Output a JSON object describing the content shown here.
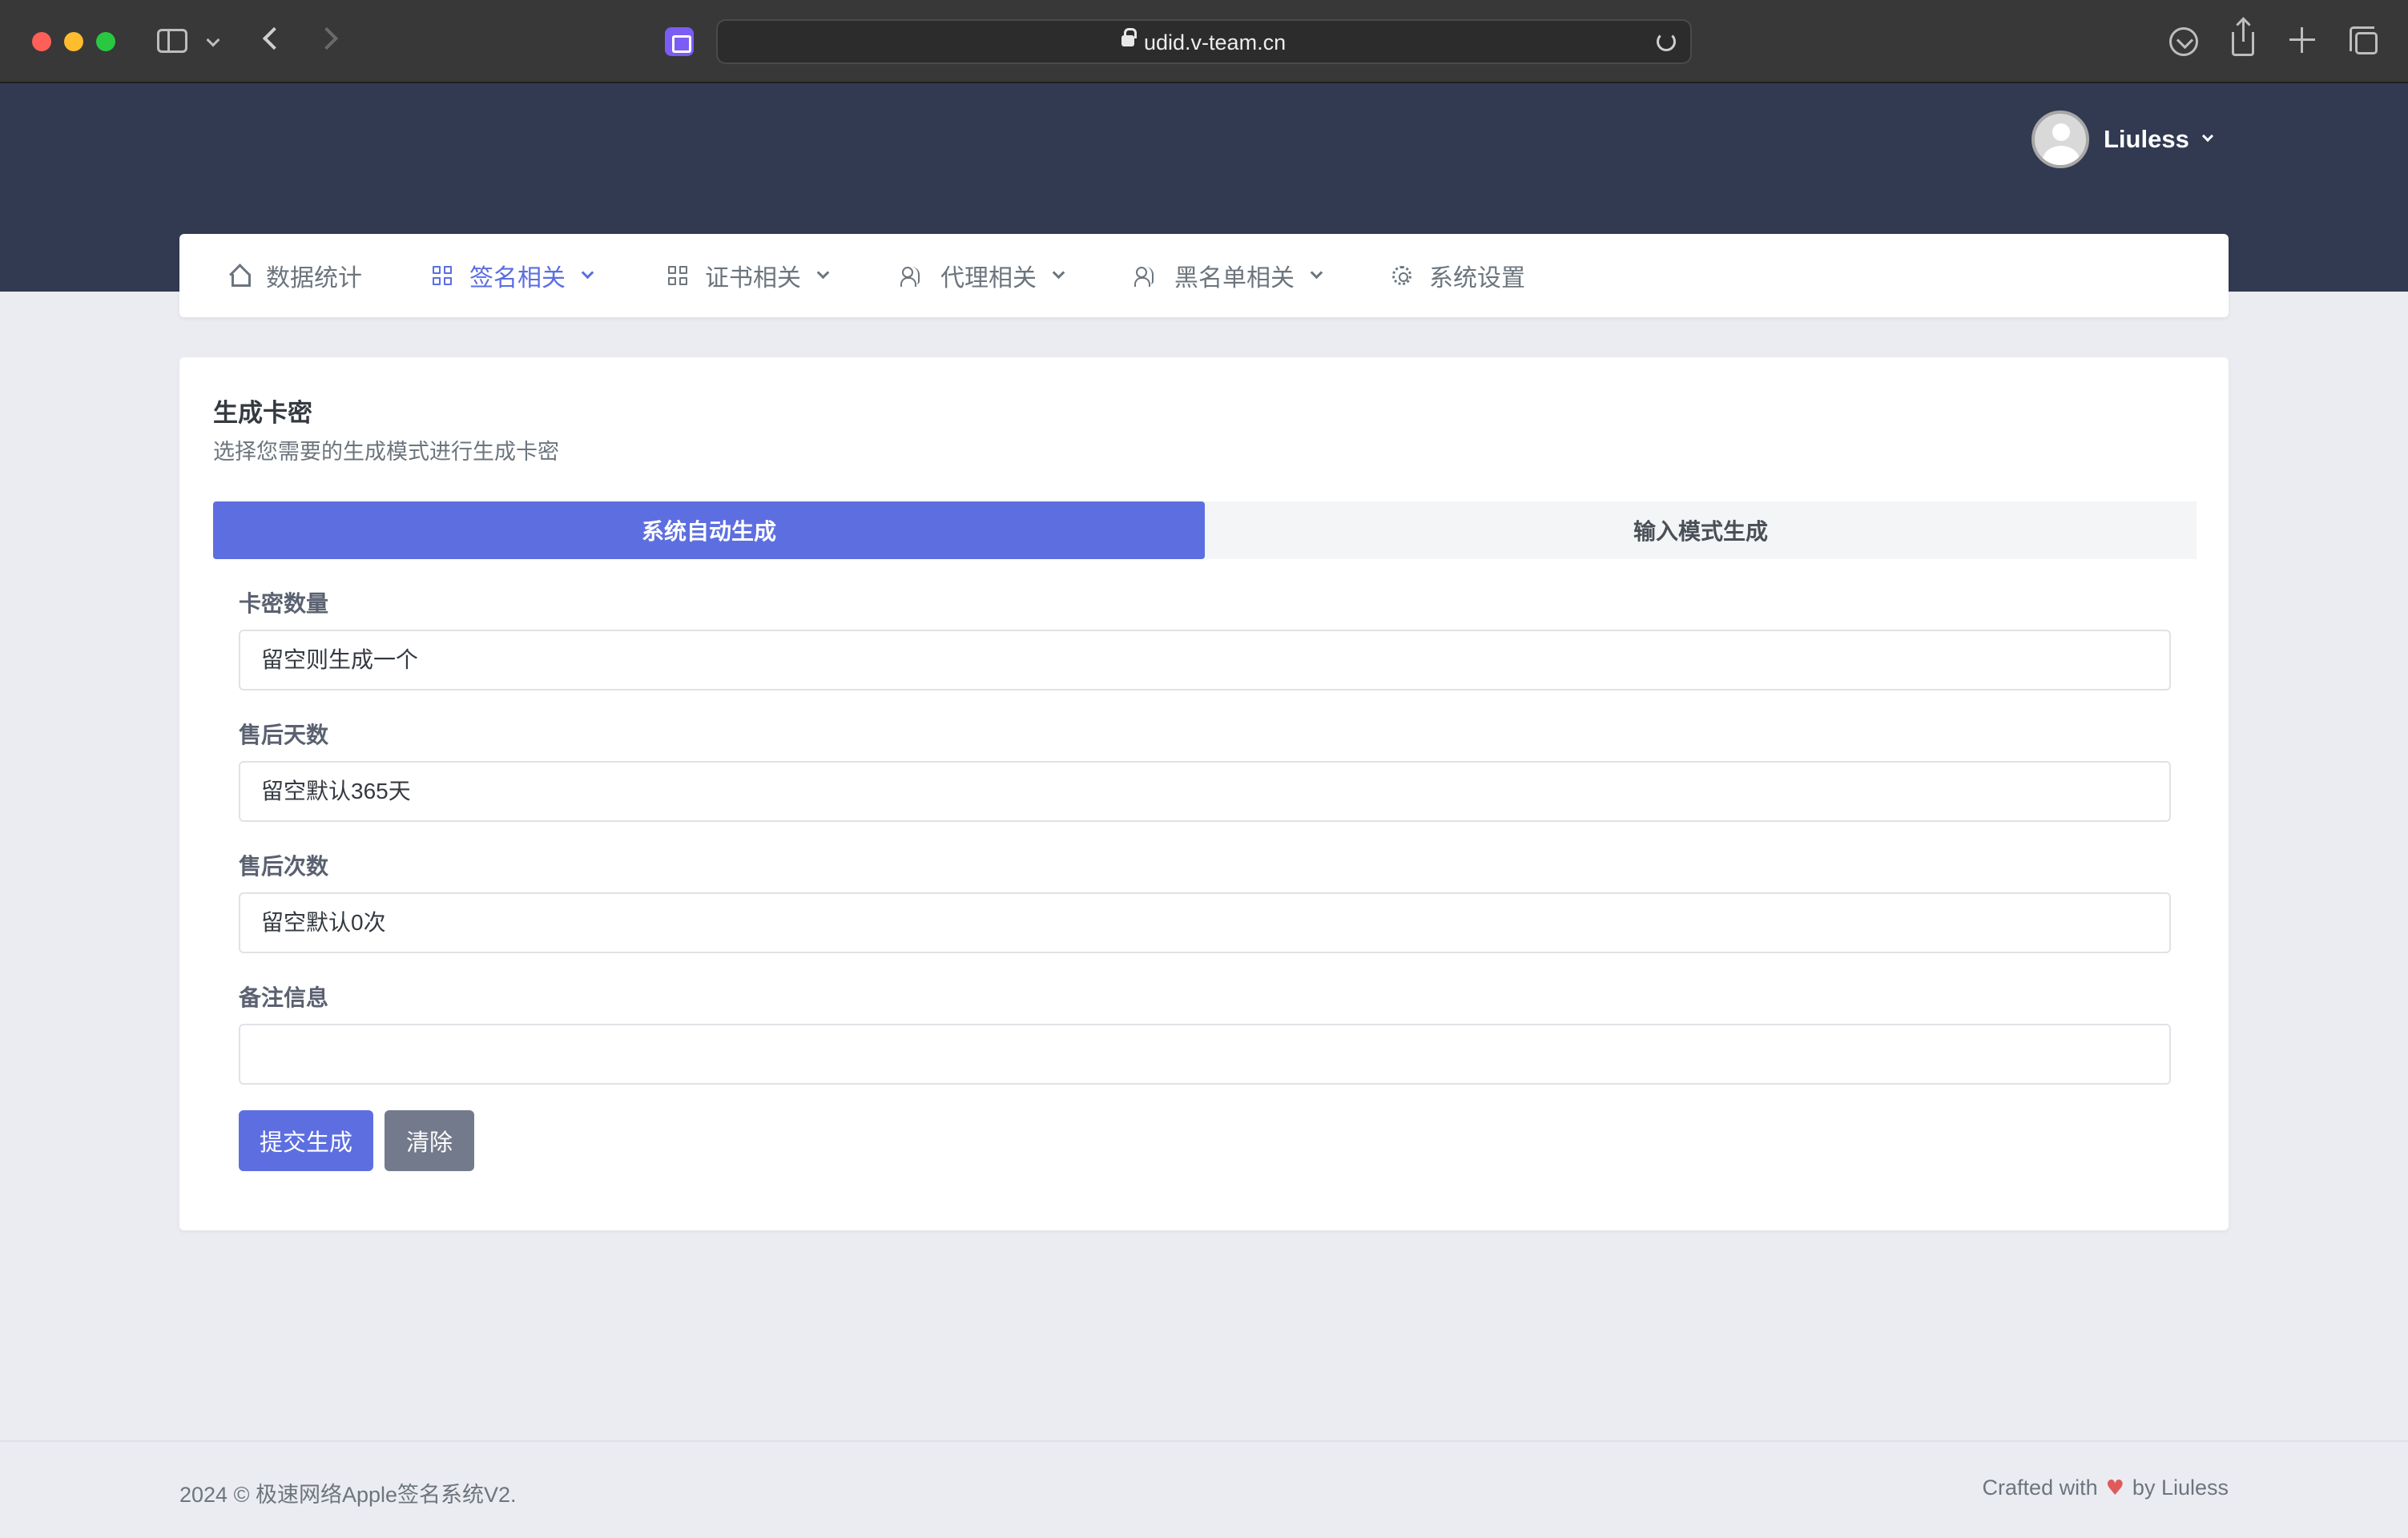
{
  "browser": {
    "url": "udid.v-team.cn"
  },
  "user": {
    "name": "Liuless"
  },
  "nav": {
    "items": [
      {
        "label": "数据统计",
        "icon": "home-icon",
        "has_dropdown": false,
        "active": false
      },
      {
        "label": "签名相关",
        "icon": "grid-icon",
        "has_dropdown": true,
        "active": true
      },
      {
        "label": "证书相关",
        "icon": "grid-icon",
        "has_dropdown": true,
        "active": false
      },
      {
        "label": "代理相关",
        "icon": "users-icon",
        "has_dropdown": true,
        "active": false
      },
      {
        "label": "黑名单相关",
        "icon": "users-icon",
        "has_dropdown": true,
        "active": false
      },
      {
        "label": "系统设置",
        "icon": "gear-icon",
        "has_dropdown": false,
        "active": false
      }
    ]
  },
  "form": {
    "title": "生成卡密",
    "subtitle": "选择您需要的生成模式进行生成卡密",
    "tabs": [
      {
        "label": "系统自动生成",
        "active": true
      },
      {
        "label": "输入模式生成",
        "active": false
      }
    ],
    "fields": {
      "quantity": {
        "label": "卡密数量",
        "placeholder": "留空则生成一个",
        "value": ""
      },
      "days": {
        "label": "售后天数",
        "placeholder": "留空默认365天",
        "value": ""
      },
      "times": {
        "label": "售后次数",
        "placeholder": "留空默认0次",
        "value": ""
      },
      "note": {
        "label": "备注信息",
        "placeholder": "",
        "value": ""
      }
    },
    "submit_label": "提交生成",
    "clear_label": "清除"
  },
  "footer": {
    "copyright": "2024 © 极速网络Apple签名系统V2.",
    "crafted_prefix": "Crafted with",
    "crafted_suffix": "by Liuless"
  },
  "colors": {
    "header_bg": "#313a51",
    "accent": "#5d6fe0",
    "secondary_button": "#737a8c",
    "page_bg": "#ebecf1",
    "heart": "#e15a5a"
  }
}
